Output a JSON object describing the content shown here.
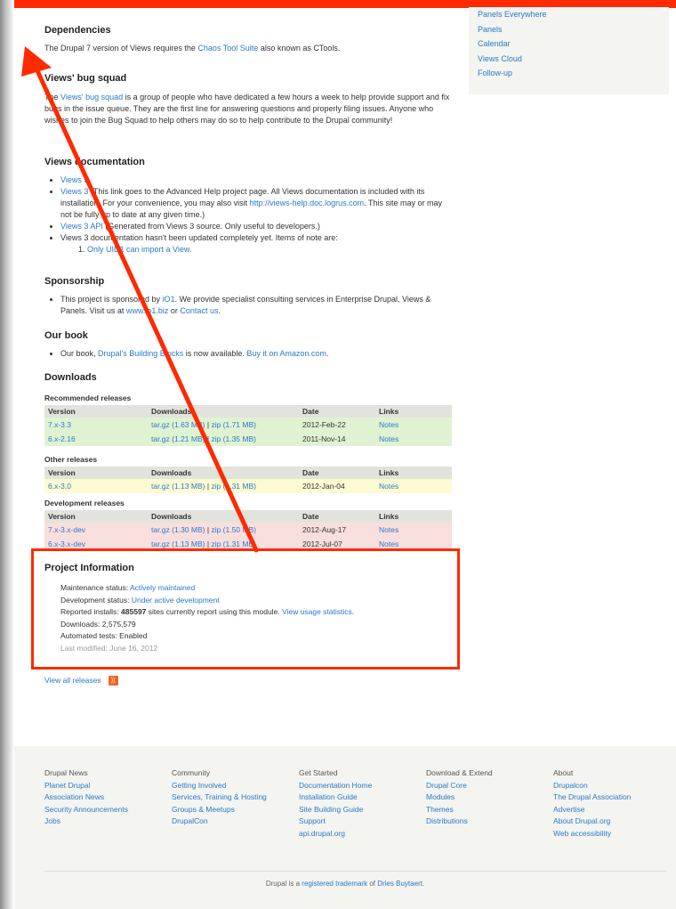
{
  "sidebar": {
    "links": [
      "Panels Everywhere",
      "Panels",
      "Calendar",
      "Views Cloud",
      "Follow-up"
    ]
  },
  "dependencies": {
    "title": "Dependencies",
    "text_before": "The Drupal 7 version of Views requires the ",
    "link": "Chaos Tool Suite",
    "text_after": " also known as CTools."
  },
  "bug_squad": {
    "title": "Views' bug squad",
    "text_before": "The ",
    "link": "Views' bug squad",
    "text_after": " is a group of people who have dedicated a few hours a week to help provide support and fix bugs in the issue queue. They are the first line for answering questions and properly filing issues. Anyone who wishes to join the Bug Squad to help others may do so to help contribute to the Drupal community!"
  },
  "documentation": {
    "title": "Views documentation",
    "item1_link": "Views 3",
    "item2_link": "Views 3",
    "item2_text": " (This link goes to the Advanced Help project page. All Views documentation is included with its installation. For your convenience, you may also visit ",
    "item2_url": "http://views-help.doc.logrus.com",
    "item2_after": ". This site may or may not be fully up to date at any given time.)",
    "item3_link": "Views 3 API",
    "item3_text": " (Generated from Views 3 source. Only useful to developers.)",
    "item4_text": "Views 3 documentation hasn't been updated completely yet. Items of note are:",
    "sub1_link": "Only UID1 can import a View."
  },
  "sponsorship": {
    "title": "Sponsorship",
    "text1": "This project is sponsored by ",
    "link1": "iO1",
    "text2": ". We provide specialist consulting services in Enterprise Drupal, Views & Panels. Visit us at ",
    "link2": "www.io1.biz",
    "text3": " or ",
    "link3": "Contact us",
    "text4": "."
  },
  "book": {
    "title": "Our book",
    "text1": "Our book, ",
    "link1": "Drupal's Building Blocks",
    "text2": " is now available. ",
    "link2": "Buy it on Amazon.com",
    "text3": "."
  },
  "downloads": {
    "title": "Downloads",
    "headers": [
      "Version",
      "Downloads",
      "Date",
      "Links"
    ],
    "recommended_label": "Recommended releases",
    "recommended": [
      {
        "version": "7.x-3.3",
        "tar": "tar.gz (1.63 MB)",
        "sep": "|",
        "zip": "zip (1.71 MB)",
        "date": "2012-Feb-22",
        "link": "Notes"
      },
      {
        "version": "6.x-2.16",
        "tar": "tar.gz (1.21 MB)",
        "sep": "|",
        "zip": "zip (1.35 MB)",
        "date": "2011-Nov-14",
        "link": "Notes"
      }
    ],
    "other_label": "Other releases",
    "other": [
      {
        "version": "6.x-3.0",
        "tar": "tar.gz (1.13 MB)",
        "sep": "|",
        "zip": "zip (1.31 MB)",
        "date": "2012-Jan-04",
        "link": "Notes"
      }
    ],
    "dev_label": "Development releases",
    "dev": [
      {
        "version": "7.x-3.x-dev",
        "tar": "tar.gz (1.30 MB)",
        "sep": "|",
        "zip": "zip (1.50 MB)",
        "date": "2012-Aug-17",
        "link": "Notes"
      },
      {
        "version": "6.x-3.x-dev",
        "tar": "tar.gz (1.13 MB)",
        "sep": "|",
        "zip": "zip (1.31 MB)",
        "date": "2012-Jul-07",
        "link": "Notes"
      }
    ]
  },
  "project_info": {
    "title": "Project Information",
    "maintenance_label": "Maintenance status: ",
    "maintenance_value": "Actively maintained",
    "development_label": "Development status: ",
    "development_value": "Under active development",
    "installs_label": "Reported installs: ",
    "installs_count": "485597",
    "installs_text": " sites currently report using this module. ",
    "installs_link": "View usage statistics",
    "installs_end": ".",
    "downloads_text": "Downloads: 2,575,579",
    "tests_text": "Automated tests: Enabled",
    "modified_text": "Last modified: June 16, 2012"
  },
  "all_releases": {
    "link": "View all releases",
    "icon": "rss-icon",
    "icon_glyph": "))"
  },
  "footer": {
    "columns": [
      {
        "heading": "Drupal News",
        "links": [
          "Planet Drupal",
          "Association News",
          "Security Announcements",
          "Jobs"
        ]
      },
      {
        "heading": "Community",
        "links": [
          "Getting Involved",
          "Services, Training & Hosting",
          "Groups & Meetups",
          "DrupalCon"
        ]
      },
      {
        "heading": "Get Started",
        "links": [
          "Documentation Home",
          "Installation Guide",
          "Site Building Guide",
          "Support",
          "api.drupal.org"
        ]
      },
      {
        "heading": "Download & Extend",
        "links": [
          "Drupal Core",
          "Modules",
          "Themes",
          "Distributions"
        ]
      },
      {
        "heading": "About",
        "links": [
          "Drupalcon",
          "The Drupal Association",
          "Advertise",
          "About Drupal.org",
          "Web accessibility"
        ]
      }
    ],
    "bottom_text1": "Drupal is a ",
    "bottom_link1": "registered trademark",
    "bottom_text2": " of ",
    "bottom_link2": "Dries Buytaert",
    "bottom_text3": "."
  },
  "annotation": {
    "color": "#ff2a00"
  }
}
